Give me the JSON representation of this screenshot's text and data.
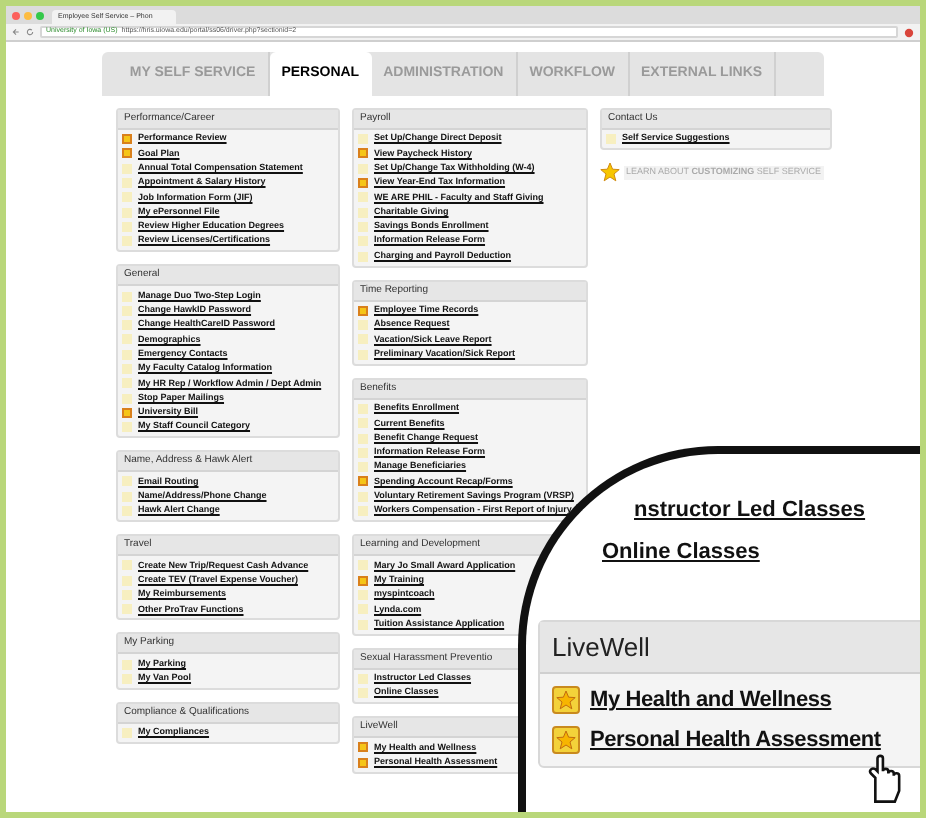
{
  "browser": {
    "tab_title": "Employee Self Service – Phon",
    "site_identity": "University of Iowa (US)",
    "url": "https://hris.uiowa.edu/portal/ss06/driver.php?sectionid=2"
  },
  "tabs": [
    {
      "label": "MY SELF SERVICE",
      "selected": false
    },
    {
      "label": "PERSONAL",
      "selected": true
    },
    {
      "label": "ADMINISTRATION",
      "selected": false
    },
    {
      "label": "WORKFLOW",
      "selected": false
    },
    {
      "label": "EXTERNAL LINKS",
      "selected": false
    }
  ],
  "columns": [
    [
      {
        "title": "Performance/Career",
        "items": [
          {
            "label": "Performance Review",
            "starred": true
          },
          {
            "label": "Goal Plan",
            "starred": true
          },
          {
            "label": "Annual Total Compensation Statement",
            "starred": false
          },
          {
            "label": "Appointment & Salary History",
            "starred": false
          },
          {
            "label": "Job Information Form (JIF)",
            "starred": false
          },
          {
            "label": "My ePersonnel File",
            "starred": false
          },
          {
            "label": "Review Higher Education Degrees",
            "starred": false
          },
          {
            "label": "Review Licenses/Certifications",
            "starred": false
          }
        ]
      },
      {
        "title": "General",
        "items": [
          {
            "label": "Manage Duo Two-Step Login",
            "starred": false
          },
          {
            "label": "Change HawkID Password",
            "starred": false
          },
          {
            "label": "Change HealthCareID Password",
            "starred": false
          },
          {
            "label": "Demographics",
            "starred": false
          },
          {
            "label": "Emergency Contacts",
            "starred": false
          },
          {
            "label": "My Faculty Catalog Information",
            "starred": false
          },
          {
            "label": "My HR Rep / Workflow Admin / Dept Admin",
            "starred": false
          },
          {
            "label": "Stop Paper Mailings",
            "starred": false
          },
          {
            "label": "University Bill",
            "starred": true
          },
          {
            "label": "My Staff Council Category",
            "starred": false
          }
        ]
      },
      {
        "title": "Name, Address & Hawk Alert",
        "items": [
          {
            "label": "Email Routing",
            "starred": false
          },
          {
            "label": "Name/Address/Phone Change",
            "starred": false
          },
          {
            "label": "Hawk Alert Change",
            "starred": false
          }
        ]
      },
      {
        "title": "Travel",
        "items": [
          {
            "label": "Create New Trip/Request Cash Advance",
            "starred": false
          },
          {
            "label": "Create TEV (Travel Expense Voucher)",
            "starred": false
          },
          {
            "label": "My Reimbursements",
            "starred": false
          },
          {
            "label": "Other ProTrav Functions",
            "starred": false
          }
        ]
      },
      {
        "title": "My Parking",
        "items": [
          {
            "label": "My Parking",
            "starred": false
          },
          {
            "label": "My Van Pool",
            "starred": false
          }
        ]
      },
      {
        "title": "Compliance & Qualifications",
        "items": [
          {
            "label": "My Compliances",
            "starred": false
          }
        ]
      }
    ],
    [
      {
        "title": "Payroll",
        "items": [
          {
            "label": "Set Up/Change Direct Deposit",
            "starred": false
          },
          {
            "label": "View Paycheck History",
            "starred": true
          },
          {
            "label": "Set Up/Change Tax Withholding (W-4)",
            "starred": false
          },
          {
            "label": "View Year-End Tax Information",
            "starred": true
          },
          {
            "label": "WE ARE PHIL - Faculty and Staff Giving",
            "starred": false
          },
          {
            "label": "Charitable Giving",
            "starred": false
          },
          {
            "label": "Savings Bonds Enrollment",
            "starred": false
          },
          {
            "label": "Information Release Form",
            "starred": false
          },
          {
            "label": "Charging and Payroll Deduction",
            "starred": false
          }
        ]
      },
      {
        "title": "Time Reporting",
        "items": [
          {
            "label": "Employee Time Records",
            "starred": true
          },
          {
            "label": "Absence Request",
            "starred": false
          },
          {
            "label": "Vacation/Sick Leave Report",
            "starred": false
          },
          {
            "label": "Preliminary Vacation/Sick Report",
            "starred": false
          }
        ]
      },
      {
        "title": "Benefits",
        "items": [
          {
            "label": "Benefits Enrollment",
            "starred": false
          },
          {
            "label": "Current Benefits",
            "starred": false
          },
          {
            "label": "Benefit Change Request",
            "starred": false
          },
          {
            "label": "Information Release Form",
            "starred": false
          },
          {
            "label": "Manage Beneficiaries",
            "starred": false
          },
          {
            "label": "Spending Account Recap/Forms",
            "starred": true
          },
          {
            "label": "Voluntary Retirement Savings Program (VRSP)",
            "starred": false
          },
          {
            "label": "Workers Compensation - First Report of Injury",
            "starred": false
          }
        ]
      },
      {
        "title": "Learning and Development",
        "items": [
          {
            "label": "Mary Jo Small Award Application",
            "starred": false
          },
          {
            "label": "My Training",
            "starred": true
          },
          {
            "label": "myspintcoach",
            "starred": false
          },
          {
            "label": "Lynda.com",
            "starred": false
          },
          {
            "label": "Tuition Assistance Application",
            "starred": false
          }
        ]
      },
      {
        "title": "Sexual Harassment Preventio",
        "items": [
          {
            "label": "Instructor Led Classes",
            "starred": false
          },
          {
            "label": "Online Classes",
            "starred": false
          }
        ]
      },
      {
        "title": "LiveWell",
        "items": [
          {
            "label": "My Health and Wellness",
            "starred": true
          },
          {
            "label": "Personal Health Assessment",
            "starred": true
          }
        ]
      }
    ],
    [
      {
        "title": "Contact Us",
        "items": [
          {
            "label": "Self Service Suggestions",
            "starred": false
          }
        ]
      }
    ]
  ],
  "promo": "LEARN ABOUT **CUSTOMIZING** SELF SERVICE",
  "magnifier": {
    "items_above": [
      {
        "label": "nstructor Led Classes"
      },
      {
        "label": "Online Classes"
      }
    ],
    "section": {
      "title": "LiveWell",
      "items": [
        {
          "label": "My Health and Wellness",
          "starred": true
        },
        {
          "label": "Personal Health Assessment",
          "starred": true
        }
      ]
    }
  }
}
